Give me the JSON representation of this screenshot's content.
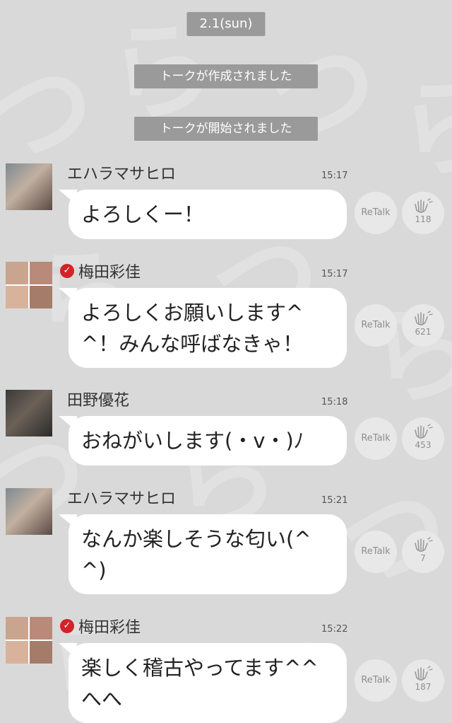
{
  "date_label": "2.1(sun)",
  "system_messages": [
    "トークが作成されました",
    "トークが開始されました"
  ],
  "retalk_label": "ReTalk",
  "clap_icon": "clap-hands-icon",
  "verified_icon": "verified-check-icon",
  "messages": [
    {
      "name": "エハラマサヒロ",
      "time": "15:17",
      "text": "よろしくー！",
      "claps": "118",
      "verified": false
    },
    {
      "name": "梅田彩佳",
      "time": "15:17",
      "text": "よろしくお願いします^^！みんな呼ばなきゃ！",
      "claps": "621",
      "verified": true
    },
    {
      "name": "田野優花",
      "time": "15:18",
      "text": "おねがいします(・v・)ﾉ",
      "claps": "453",
      "verified": false
    },
    {
      "name": "エハラマサヒロ",
      "time": "15:21",
      "text": "なんか楽しそうな匂い(^^)",
      "claps": "7",
      "verified": false
    },
    {
      "name": "梅田彩佳",
      "time": "15:22",
      "text": "楽しく稽古やってます^^へへ",
      "claps": "187",
      "verified": true
    }
  ],
  "colors": {
    "background": "#d9d9d9",
    "pill": "#9a9a9a",
    "verified": "#d2232a"
  }
}
